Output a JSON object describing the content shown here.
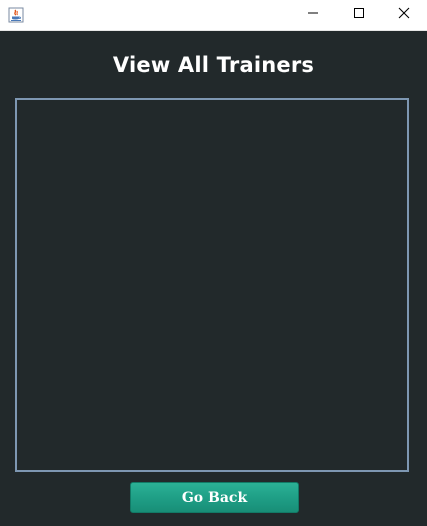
{
  "window": {
    "icons": {
      "app": "java-app-icon",
      "minimize": "minimize-icon",
      "maximize": "maximize-icon",
      "close": "close-icon"
    }
  },
  "main": {
    "title": "View All Trainers",
    "trainers": [],
    "go_back_label": "Go Back"
  },
  "colors": {
    "background": "#22292b",
    "list_border": "#7e97b2",
    "button": "#1f9f86",
    "title_text": "#ffffff"
  }
}
